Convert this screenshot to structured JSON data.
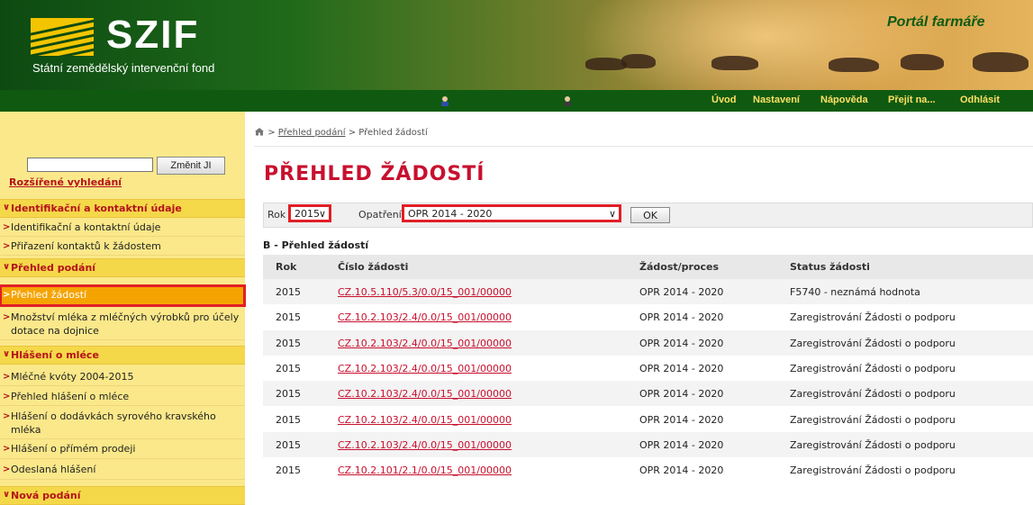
{
  "header": {
    "logo_text": "SZIF",
    "logo_subtitle": "Státní zemědělský intervenční fond",
    "portal_title": "Portál farmáře"
  },
  "nav": {
    "links": [
      "Úvod",
      "Nastavení",
      "Nápověda",
      "Přejít na...",
      "Odhlásit"
    ]
  },
  "sidebar": {
    "search_value": "",
    "change_button": "Změnit JI",
    "advanced_search": "Rozšířené vyhledání",
    "sections": [
      {
        "title": "Identifikační a kontaktní údaje",
        "items": [
          "Identifikační a kontaktní údaje",
          "Přiřazení kontaktů k žádostem"
        ]
      },
      {
        "title": "Přehled podání",
        "items": [
          "Přehled žádostí",
          "Množství mléka z mléčných výrobků pro účely dotace na dojnice"
        ]
      },
      {
        "title": "Hlášení o mléce",
        "items": [
          "Mléčné kvóty 2004-2015",
          "Přehled hlášení o mléce",
          "Hlášení o dodávkách syrového kravského mléka",
          "Hlášení o přímém prodeji",
          "Odeslaná hlášení"
        ]
      },
      {
        "title": "Nová podání",
        "items": []
      }
    ],
    "active_item": "Přehled žádostí"
  },
  "breadcrumb": {
    "separator": ">",
    "items": [
      "Přehled podání",
      "Přehled žádostí"
    ]
  },
  "page_title": "PŘEHLED ŽÁDOSTÍ",
  "filter": {
    "year_label": "Rok",
    "year_value": "2015",
    "measure_label": "Opatření",
    "measure_value": "OPR 2014 - 2020",
    "ok_button": "OK"
  },
  "table": {
    "heading": "B - Přehled žádostí",
    "columns": [
      "Rok",
      "Číslo žádosti",
      "Žádost/proces",
      "Status žádosti"
    ],
    "rows": [
      [
        "2015",
        "CZ.10.5.110/5.3/0.0/15_001/00000",
        "OPR 2014 - 2020",
        "F5740 - neznámá hodnota"
      ],
      [
        "2015",
        "CZ.10.2.103/2.4/0.0/15_001/00000",
        "OPR 2014 - 2020",
        "Zaregistrování Žádosti o podporu"
      ],
      [
        "2015",
        "CZ.10.2.103/2.4/0.0/15_001/00000",
        "OPR 2014 - 2020",
        "Zaregistrování Žádosti o podporu"
      ],
      [
        "2015",
        "CZ.10.2.103/2.4/0.0/15_001/00000",
        "OPR 2014 - 2020",
        "Zaregistrování Žádosti o podporu"
      ],
      [
        "2015",
        "CZ.10.2.103/2.4/0.0/15_001/00000",
        "OPR 2014 - 2020",
        "Zaregistrování Žádosti o podporu"
      ],
      [
        "2015",
        "CZ.10.2.103/2.4/0.0/15_001/00000",
        "OPR 2014 - 2020",
        "Zaregistrování Žádosti o podporu"
      ],
      [
        "2015",
        "CZ.10.2.103/2.4/0.0/15_001/00000",
        "OPR 2014 - 2020",
        "Zaregistrování Žádosti o podporu"
      ],
      [
        "2015",
        "CZ.10.2.101/2.1/0.0/15_001/00000",
        "OPR 2014 - 2020",
        "Zaregistrování Žádosti o podporu"
      ]
    ]
  },
  "colors": {
    "brand_green": "#0f5a10",
    "brand_yellow": "#f2c500",
    "accent_red": "#c8102e",
    "highlight_red": "#e21e26",
    "sidebar_bg": "#fae88a",
    "active_item_bg": "#f5a300"
  }
}
